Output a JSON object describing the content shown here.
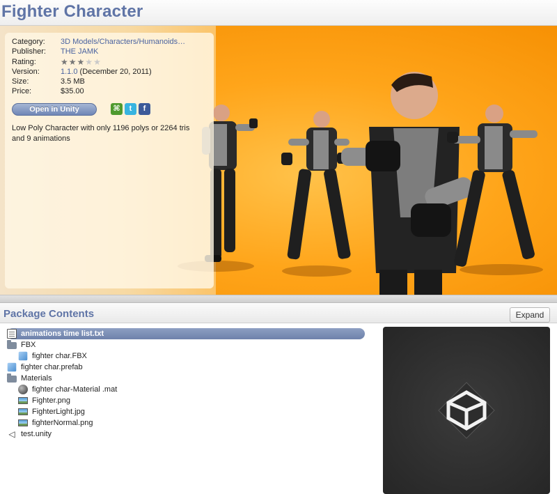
{
  "title": "Fighter Character",
  "info": {
    "category_label": "Category:",
    "category_value": "3D Models/Characters/Humanoids…",
    "publisher_label": "Publisher:",
    "publisher_value": "THE JAMK",
    "rating_label": "Rating:",
    "rating_stars": 3,
    "rating_max": 5,
    "version_label": "Version:",
    "version_number": "1.1.0",
    "version_date": "(December 20, 2011)",
    "size_label": "Size:",
    "size_value": "3.5 MB",
    "price_label": "Price:",
    "price_value": "$35.00",
    "open_button": "Open in Unity",
    "share_icons": [
      "myspace-icon",
      "twitter-icon",
      "facebook-icon"
    ],
    "description": "Low Poly Character with only 1196 polys or 2264 tris and 9 animations"
  },
  "package": {
    "header": "Package Contents",
    "expand_label": "Expand",
    "items": [
      {
        "label": "animations time list.txt",
        "icon": "text-file-icon",
        "level": 0,
        "selected": true
      },
      {
        "label": "FBX",
        "icon": "folder-icon",
        "level": 0,
        "selected": false
      },
      {
        "label": "fighter char.FBX",
        "icon": "model-cube-icon",
        "level": 1,
        "selected": false
      },
      {
        "label": "fighter char.prefab",
        "icon": "prefab-cube-icon",
        "level": 0,
        "selected": false
      },
      {
        "label": "Materials",
        "icon": "folder-icon",
        "level": 0,
        "selected": false
      },
      {
        "label": "fighter char-Material .mat",
        "icon": "material-sphere-icon",
        "level": 1,
        "selected": false
      },
      {
        "label": "Fighter.png",
        "icon": "image-icon",
        "level": 1,
        "selected": false
      },
      {
        "label": "FighterLight.jpg",
        "icon": "image-icon",
        "level": 1,
        "selected": false
      },
      {
        "label": "fighterNormal.png",
        "icon": "image-icon",
        "level": 1,
        "selected": false
      },
      {
        "label": "test.unity",
        "icon": "unity-scene-icon",
        "level": 0,
        "selected": false
      }
    ]
  },
  "colors": {
    "title": "#5f74a6",
    "hero_orange": "#ffa51a",
    "selected_row": "#7a8db4"
  }
}
